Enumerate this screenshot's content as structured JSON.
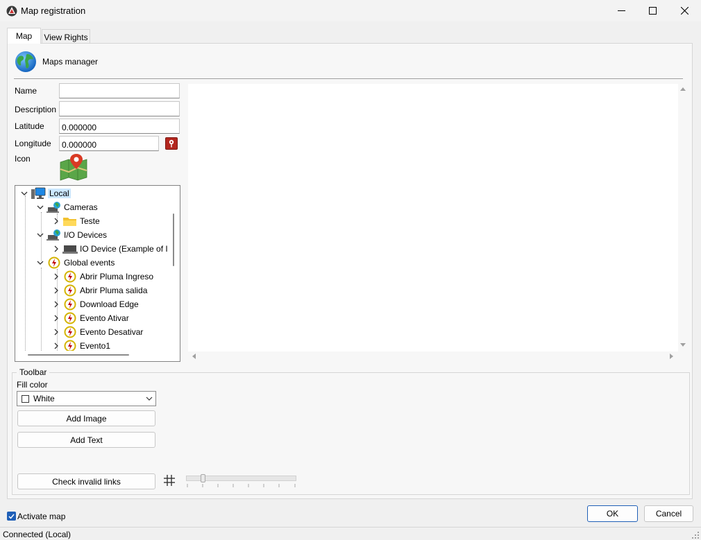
{
  "window": {
    "title": "Map registration"
  },
  "tabs": [
    {
      "label": "Map"
    },
    {
      "label": "View Rights"
    }
  ],
  "header": {
    "title": "Maps manager"
  },
  "form": {
    "name_label": "Name",
    "name_value": "",
    "description_label": "Description",
    "description_value": "",
    "latitude_label": "Latitude",
    "latitude_value": "0.000000",
    "longitude_label": "Longitude",
    "longitude_value": "0.000000",
    "icon_label": "Icon"
  },
  "tree": {
    "items": [
      {
        "label": "Local",
        "icon": "computer-icon",
        "selected": true
      },
      {
        "label": "Cameras",
        "icon": "camera-group-icon"
      },
      {
        "label": "Teste",
        "icon": "folder-icon"
      },
      {
        "label": "I/O Devices",
        "icon": "io-devices-icon"
      },
      {
        "label": "IO Device (Example of I",
        "icon": "io-device-icon"
      },
      {
        "label": "Global events",
        "icon": "event-icon"
      },
      {
        "label": "Abrir Pluma Ingreso",
        "icon": "event-icon"
      },
      {
        "label": "Abrir Pluma salida",
        "icon": "event-icon"
      },
      {
        "label": "Download Edge",
        "icon": "event-icon"
      },
      {
        "label": "Evento Ativar",
        "icon": "event-icon"
      },
      {
        "label": "Evento Desativar",
        "icon": "event-icon"
      },
      {
        "label": "Evento1",
        "icon": "event-icon"
      }
    ]
  },
  "toolbar": {
    "title": "Toolbar",
    "fill_color_label": "Fill color",
    "fill_color_value": "White",
    "add_image_label": "Add Image",
    "add_text_label": "Add Text",
    "check_links_label": "Check invalid links"
  },
  "footer": {
    "activate_map_label": "Activate map",
    "activate_map_checked": true,
    "ok_label": "OK",
    "cancel_label": "Cancel"
  },
  "status": {
    "text": "Connected (Local)"
  },
  "colors": {
    "accent": "#1f5fb7",
    "selection": "#cce8ff",
    "event_ring": "#d4b400",
    "event_bolt": "#c00000"
  }
}
